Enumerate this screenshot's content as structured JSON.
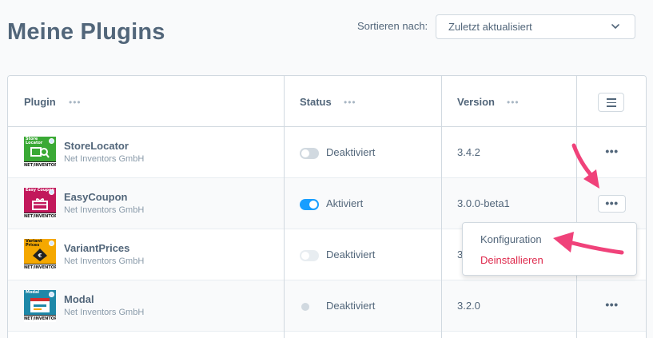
{
  "page": {
    "title": "Meine Plugins"
  },
  "sort": {
    "label": "Sortieren nach:",
    "selected": "Zuletzt aktualisiert"
  },
  "grid": {
    "columns": [
      {
        "label": "Plugin"
      },
      {
        "label": "Status"
      },
      {
        "label": "Version"
      }
    ],
    "rows": [
      {
        "name": "StoreLocator",
        "vendor": "Net Inventors GmbH",
        "status": "Deaktiviert",
        "active": false,
        "version": "3.4.2",
        "thumb_label": "Store Locator",
        "thumb_color": "#3aa935",
        "thumb_brand": "NET/INVENTORS"
      },
      {
        "name": "EasyCoupon",
        "vendor": "Net Inventors GmbH",
        "status": "Aktiviert",
        "active": true,
        "version": "3.0.0-beta1",
        "thumb_label": "Easy Coupon",
        "thumb_color": "#c2185b",
        "thumb_brand": "NET/INVENTORS"
      },
      {
        "name": "VariantPrices",
        "vendor": "Net Inventors GmbH",
        "status": "Deaktiviert",
        "active": false,
        "version": "3",
        "thumb_label": "Variant Prices",
        "thumb_color": "#f5a800",
        "thumb_brand": "NET/INVENTORS"
      },
      {
        "name": "Modal",
        "vendor": "Net Inventors GmbH",
        "status": "Deaktiviert",
        "active": false,
        "version": "3.2.0",
        "thumb_label": "Modal",
        "thumb_color": "#1e88a8",
        "thumb_brand": "NET/INVENTORS"
      }
    ]
  },
  "context_menu": {
    "items": [
      {
        "label": "Konfiguration"
      },
      {
        "label": "Deinstallieren"
      }
    ]
  },
  "icons": {
    "row_actions": "more-horizontal-icon",
    "column_settings": "hamburger-menu-icon",
    "sort_chevron": "chevron-down-icon",
    "annotation": "pink-arrow-icon"
  },
  "colors": {
    "accent": "#189eff",
    "danger": "#de294c",
    "annotation": "#f0427a"
  }
}
